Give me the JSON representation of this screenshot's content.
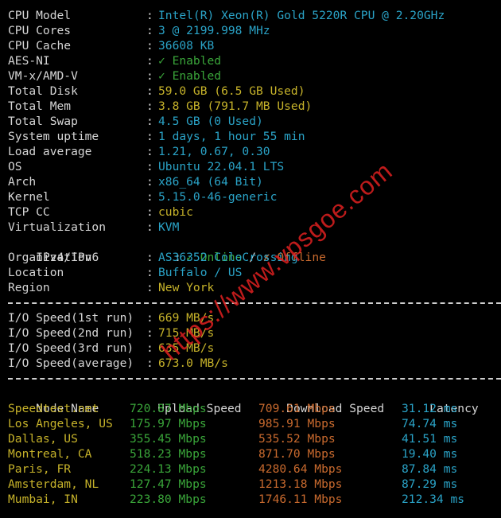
{
  "colors": {
    "background": "#000000",
    "label": "#d6d6d6",
    "cyan": "#2aa3c7",
    "yellow": "#c7b32a",
    "green": "#3aa63a",
    "orange": "#c96a2e",
    "watermark": "#e02020"
  },
  "sysinfo": [
    {
      "key": "CPU Model",
      "value": "Intel(R) Xeon(R) Gold 5220R CPU @ 2.20GHz",
      "color": "cyan"
    },
    {
      "key": "CPU Cores",
      "value": "3 @ 2199.998 MHz",
      "color": "cyan"
    },
    {
      "key": "CPU Cache",
      "value": "36608 KB",
      "color": "cyan"
    },
    {
      "key": "AES-NI",
      "value": "✓ Enabled",
      "color": "green"
    },
    {
      "key": "VM-x/AMD-V",
      "value": "✓ Enabled",
      "color": "green"
    },
    {
      "key": "Total Disk",
      "value": "59.0 GB (6.5 GB Used)",
      "color": "yellow"
    },
    {
      "key": "Total Mem",
      "value": "3.8 GB (791.7 MB Used)",
      "color": "yellow"
    },
    {
      "key": "Total Swap",
      "value": "4.5 GB (0 Used)",
      "color": "cyan"
    },
    {
      "key": "System uptime",
      "value": "1 days, 1 hour 55 min",
      "color": "cyan"
    },
    {
      "key": "Load average",
      "value": "1.21, 0.67, 0.30",
      "color": "cyan"
    },
    {
      "key": "OS",
      "value": "Ubuntu 22.04.1 LTS",
      "color": "cyan"
    },
    {
      "key": "Arch",
      "value": "x86_64 (64 Bit)",
      "color": "cyan"
    },
    {
      "key": "Kernel",
      "value": "5.15.0-46-generic",
      "color": "cyan"
    },
    {
      "key": "TCP CC",
      "value": "cubic",
      "color": "yellow"
    },
    {
      "key": "Virtualization",
      "value": "KVM",
      "color": "cyan"
    }
  ],
  "ip": {
    "key": "IPv4/IPv6",
    "online": "✓ Online",
    "slash": " / ",
    "offline": "✗ Offline"
  },
  "sysinfo2": [
    {
      "key": "Organization",
      "value": "AS36352 ColoCrossing",
      "color": "cyan"
    },
    {
      "key": "Location",
      "value": "Buffalo / US",
      "color": "cyan"
    },
    {
      "key": "Region",
      "value": "New York",
      "color": "yellow"
    }
  ],
  "io": [
    {
      "key": "I/O Speed(1st run)",
      "value": "669 MB/s"
    },
    {
      "key": "I/O Speed(2nd run)",
      "value": "715 MB/s"
    },
    {
      "key": "I/O Speed(3rd run)",
      "value": "635 MB/s"
    },
    {
      "key": "I/O Speed(average)",
      "value": "673.0 MB/s"
    }
  ],
  "speedtest": {
    "headers": [
      "Node Name",
      "Upload Speed",
      "Download Speed",
      "Latency"
    ],
    "rows": [
      {
        "node": "Speedtest.net",
        "upload": "720.87 Mbps",
        "download": "709.61 Mbps",
        "latency": "31.12 ms"
      },
      {
        "node": "Los Angeles, US",
        "upload": "175.97 Mbps",
        "download": "985.91 Mbps",
        "latency": "74.74 ms"
      },
      {
        "node": "Dallas, US",
        "upload": "355.45 Mbps",
        "download": "535.52 Mbps",
        "latency": "41.51 ms"
      },
      {
        "node": "Montreal, CA",
        "upload": "518.23 Mbps",
        "download": "871.70 Mbps",
        "latency": "19.40 ms"
      },
      {
        "node": "Paris, FR",
        "upload": "224.13 Mbps",
        "download": "4280.64 Mbps",
        "latency": "87.84 ms"
      },
      {
        "node": "Amsterdam, NL",
        "upload": "127.47 Mbps",
        "download": "1213.18 Mbps",
        "latency": "87.29 ms"
      },
      {
        "node": "Mumbai, IN",
        "upload": "223.80 Mbps",
        "download": "1746.11 Mbps",
        "latency": "212.34 ms"
      }
    ]
  },
  "watermark": "https://www.vpsgoe.com"
}
